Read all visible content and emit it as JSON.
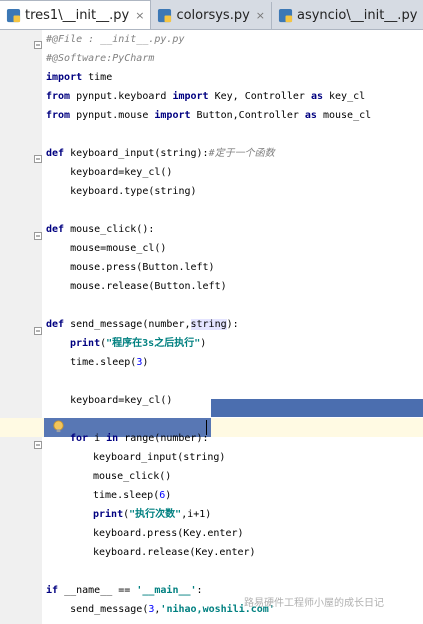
{
  "tabs": [
    {
      "label": "tres1\\__init__.py",
      "close": "×",
      "active": true
    },
    {
      "label": "colorsys.py",
      "close": "×",
      "active": false
    },
    {
      "label": "asyncio\\__init__.py",
      "close": "×",
      "active": false
    }
  ],
  "code": {
    "l1": "#@File : __init__.py.py",
    "l2": "#@Software:PyCharm",
    "l3_kw": "import",
    "l3_rest": " time",
    "l4_kw1": "from",
    "l4_mid": " pynput.keyboard ",
    "l4_kw2": "import",
    "l4_mid2": " Key, Controller ",
    "l4_kw3": "as",
    "l4_end": " key_cl",
    "l5_kw1": "from",
    "l5_mid": " pynput.mouse ",
    "l5_kw2": "import",
    "l5_mid2": " Button,Controller ",
    "l5_kw3": "as",
    "l5_end": " mouse_cl",
    "l6_kw": "def",
    "l6_rest": " keyboard_input(string):",
    "l6_cm": "#定于一个函数",
    "l7": "    keyboard=key_cl()",
    "l8": "    keyboard.type(string)",
    "l9_kw": "def",
    "l9_rest": " mouse_click():",
    "l10": "    mouse=mouse_cl()",
    "l11": "    mouse.press(Button.left)",
    "l12": "    mouse.release(Button.left)",
    "l13_kw": "def",
    "l13_rest": " send_message(number,",
    "l13_param": "string",
    "l13_end": "):",
    "l14_kw": "print",
    "l14_open": "(",
    "l14_str": "\"程序在3s之后执行\"",
    "l14_close": ")",
    "l15_pre": "    time.sleep(",
    "l15_num": "3",
    "l15_close": ")",
    "l16": "    keyboard=key_cl()",
    "l17_kw1": "for",
    "l17_mid": " i ",
    "l17_kw2": "in",
    "l17_mid2": " range(number):",
    "l18": "keyboard_input(string)",
    "l19": "mouse_click()",
    "l20_pre": "time.sleep(",
    "l20_num": "6",
    "l20_close": ")",
    "l21_kw": "print",
    "l21_open": "(",
    "l21_str": "\"执行次数\"",
    "l21_close": ",i+1)",
    "l22": "keyboard.press(Key.enter)",
    "l23": "keyboard.release(Key.enter)",
    "l24_kw": "if",
    "l24_mid": " __name__ == ",
    "l24_str": "'__main__'",
    "l24_end": ":",
    "l25_pre": "    send_message(",
    "l25_num": "3",
    "l25_mid": ",",
    "l25_str": "'nihao,woshili.com'"
  },
  "watermark": "路易硬件工程师小屋的成长日记",
  "colors": {
    "keyword": "#000080",
    "comment": "#808080",
    "string": "#008080",
    "number": "#0000ff",
    "selection": "#4b6eaf",
    "current_line": "#fffae3"
  }
}
